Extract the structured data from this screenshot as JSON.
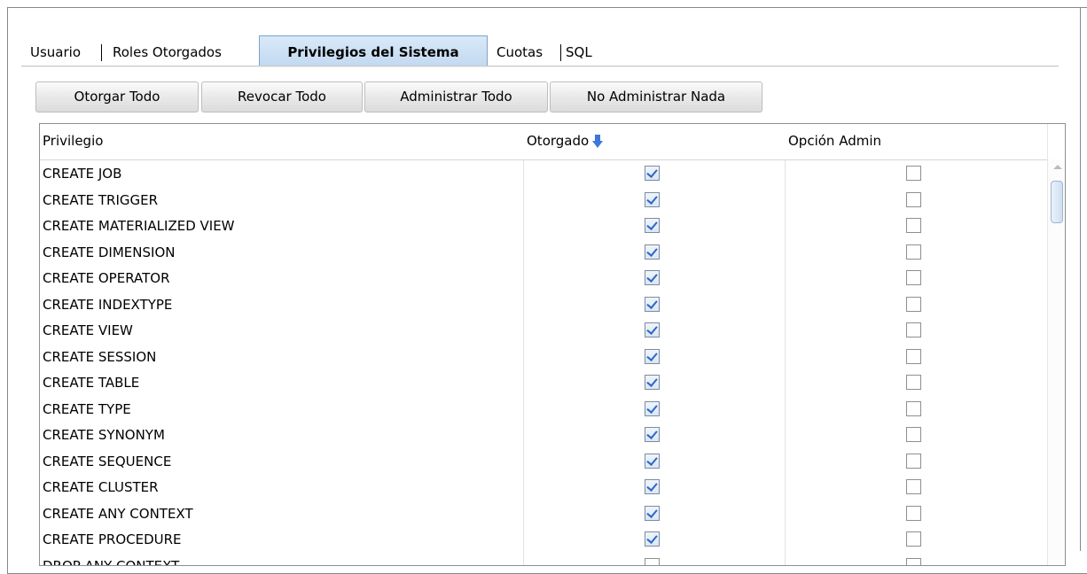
{
  "tabs": {
    "usuario": "Usuario",
    "roles": "Roles Otorgados",
    "privilegios": "Privilegios del Sistema",
    "cuotas": "Cuotas",
    "sql": "SQL"
  },
  "toolbar": {
    "grant_all": "Otorgar Todo",
    "revoke_all": "Revocar Todo",
    "admin_all": "Administrar Todo",
    "admin_none": "No Administrar Nada"
  },
  "table": {
    "headers": {
      "privilegio": "Privilegio",
      "otorgado": "Otorgado",
      "opcion_admin": "Opción Admin"
    },
    "sort_icon": "sort-descending-icon",
    "accent_color": "#3b78d8",
    "rows": [
      {
        "name": "CREATE JOB",
        "granted": true,
        "admin": false
      },
      {
        "name": "CREATE TRIGGER",
        "granted": true,
        "admin": false
      },
      {
        "name": "CREATE MATERIALIZED VIEW",
        "granted": true,
        "admin": false
      },
      {
        "name": "CREATE DIMENSION",
        "granted": true,
        "admin": false
      },
      {
        "name": "CREATE OPERATOR",
        "granted": true,
        "admin": false
      },
      {
        "name": "CREATE INDEXTYPE",
        "granted": true,
        "admin": false
      },
      {
        "name": "CREATE VIEW",
        "granted": true,
        "admin": false
      },
      {
        "name": "CREATE SESSION",
        "granted": true,
        "admin": false
      },
      {
        "name": "CREATE TABLE",
        "granted": true,
        "admin": false
      },
      {
        "name": "CREATE TYPE",
        "granted": true,
        "admin": false
      },
      {
        "name": "CREATE SYNONYM",
        "granted": true,
        "admin": false
      },
      {
        "name": "CREATE SEQUENCE",
        "granted": true,
        "admin": false
      },
      {
        "name": "CREATE CLUSTER",
        "granted": true,
        "admin": false
      },
      {
        "name": "CREATE ANY CONTEXT",
        "granted": true,
        "admin": false
      },
      {
        "name": "CREATE PROCEDURE",
        "granted": true,
        "admin": false
      },
      {
        "name": "DROP ANY CONTEXT",
        "granted": false,
        "admin": false
      }
    ]
  }
}
